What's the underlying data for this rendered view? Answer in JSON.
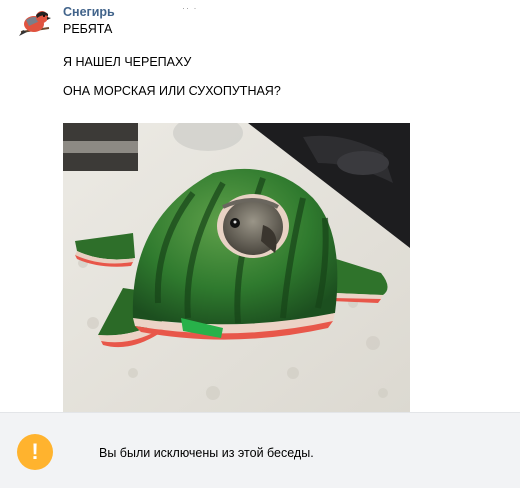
{
  "message": {
    "author": "Снегирь",
    "lines": [
      "РЕБЯТА",
      "Я НАШЕЛ ЧЕРЕПАХУ",
      "ОНА МОРСКАЯ ИЛИ СУХОПУТНАЯ?"
    ],
    "photo_icon": "watermelon-turtle-parrot-photo",
    "avatar_icon": "bullfinch-avatar-icon"
  },
  "notice": {
    "icon": "exclamation-icon",
    "icon_glyph": "!",
    "text": "Вы были исключены из этой беседы."
  },
  "colors": {
    "author": "#42648b",
    "notice_bg": "#f2f3f5",
    "notice_icon": "#ffb32e"
  }
}
